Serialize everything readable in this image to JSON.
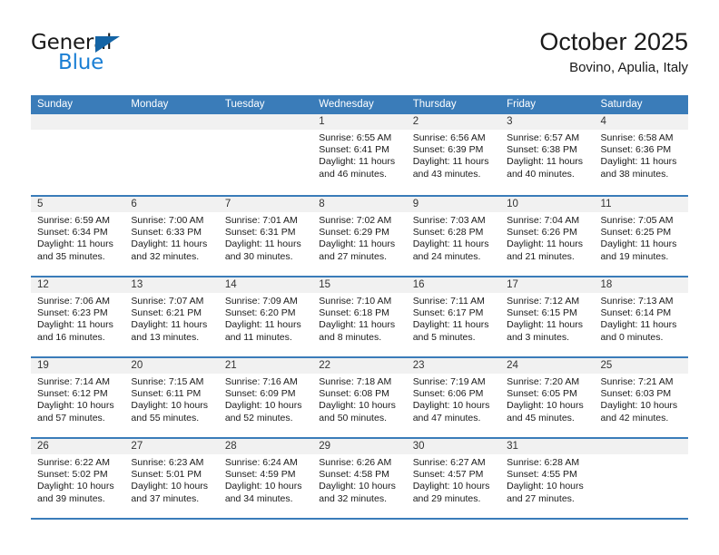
{
  "brand": {
    "name_part1": "General",
    "name_part2": "Blue",
    "accent_color": "#1b7fd4",
    "triangle_color": "#1464a5",
    "triangle_icon": "triangle-icon"
  },
  "header": {
    "title": "October 2025",
    "subtitle": "Bovino, Apulia, Italy"
  },
  "calendar": {
    "header_bg": "#3a7cb9",
    "day_band_bg": "#f1f1f1",
    "weekday_headers": [
      "Sunday",
      "Monday",
      "Tuesday",
      "Wednesday",
      "Thursday",
      "Friday",
      "Saturday"
    ],
    "weeks": [
      [
        {
          "day": "",
          "empty": true,
          "sunrise": "",
          "sunset": "",
          "daylight_line1": "",
          "daylight_line2": ""
        },
        {
          "day": "",
          "empty": true,
          "sunrise": "",
          "sunset": "",
          "daylight_line1": "",
          "daylight_line2": ""
        },
        {
          "day": "",
          "empty": true,
          "sunrise": "",
          "sunset": "",
          "daylight_line1": "",
          "daylight_line2": ""
        },
        {
          "day": "1",
          "empty": false,
          "sunrise": "Sunrise: 6:55 AM",
          "sunset": "Sunset: 6:41 PM",
          "daylight_line1": "Daylight: 11 hours",
          "daylight_line2": "and 46 minutes."
        },
        {
          "day": "2",
          "empty": false,
          "sunrise": "Sunrise: 6:56 AM",
          "sunset": "Sunset: 6:39 PM",
          "daylight_line1": "Daylight: 11 hours",
          "daylight_line2": "and 43 minutes."
        },
        {
          "day": "3",
          "empty": false,
          "sunrise": "Sunrise: 6:57 AM",
          "sunset": "Sunset: 6:38 PM",
          "daylight_line1": "Daylight: 11 hours",
          "daylight_line2": "and 40 minutes."
        },
        {
          "day": "4",
          "empty": false,
          "sunrise": "Sunrise: 6:58 AM",
          "sunset": "Sunset: 6:36 PM",
          "daylight_line1": "Daylight: 11 hours",
          "daylight_line2": "and 38 minutes."
        }
      ],
      [
        {
          "day": "5",
          "empty": false,
          "sunrise": "Sunrise: 6:59 AM",
          "sunset": "Sunset: 6:34 PM",
          "daylight_line1": "Daylight: 11 hours",
          "daylight_line2": "and 35 minutes."
        },
        {
          "day": "6",
          "empty": false,
          "sunrise": "Sunrise: 7:00 AM",
          "sunset": "Sunset: 6:33 PM",
          "daylight_line1": "Daylight: 11 hours",
          "daylight_line2": "and 32 minutes."
        },
        {
          "day": "7",
          "empty": false,
          "sunrise": "Sunrise: 7:01 AM",
          "sunset": "Sunset: 6:31 PM",
          "daylight_line1": "Daylight: 11 hours",
          "daylight_line2": "and 30 minutes."
        },
        {
          "day": "8",
          "empty": false,
          "sunrise": "Sunrise: 7:02 AM",
          "sunset": "Sunset: 6:29 PM",
          "daylight_line1": "Daylight: 11 hours",
          "daylight_line2": "and 27 minutes."
        },
        {
          "day": "9",
          "empty": false,
          "sunrise": "Sunrise: 7:03 AM",
          "sunset": "Sunset: 6:28 PM",
          "daylight_line1": "Daylight: 11 hours",
          "daylight_line2": "and 24 minutes."
        },
        {
          "day": "10",
          "empty": false,
          "sunrise": "Sunrise: 7:04 AM",
          "sunset": "Sunset: 6:26 PM",
          "daylight_line1": "Daylight: 11 hours",
          "daylight_line2": "and 21 minutes."
        },
        {
          "day": "11",
          "empty": false,
          "sunrise": "Sunrise: 7:05 AM",
          "sunset": "Sunset: 6:25 PM",
          "daylight_line1": "Daylight: 11 hours",
          "daylight_line2": "and 19 minutes."
        }
      ],
      [
        {
          "day": "12",
          "empty": false,
          "sunrise": "Sunrise: 7:06 AM",
          "sunset": "Sunset: 6:23 PM",
          "daylight_line1": "Daylight: 11 hours",
          "daylight_line2": "and 16 minutes."
        },
        {
          "day": "13",
          "empty": false,
          "sunrise": "Sunrise: 7:07 AM",
          "sunset": "Sunset: 6:21 PM",
          "daylight_line1": "Daylight: 11 hours",
          "daylight_line2": "and 13 minutes."
        },
        {
          "day": "14",
          "empty": false,
          "sunrise": "Sunrise: 7:09 AM",
          "sunset": "Sunset: 6:20 PM",
          "daylight_line1": "Daylight: 11 hours",
          "daylight_line2": "and 11 minutes."
        },
        {
          "day": "15",
          "empty": false,
          "sunrise": "Sunrise: 7:10 AM",
          "sunset": "Sunset: 6:18 PM",
          "daylight_line1": "Daylight: 11 hours",
          "daylight_line2": "and 8 minutes."
        },
        {
          "day": "16",
          "empty": false,
          "sunrise": "Sunrise: 7:11 AM",
          "sunset": "Sunset: 6:17 PM",
          "daylight_line1": "Daylight: 11 hours",
          "daylight_line2": "and 5 minutes."
        },
        {
          "day": "17",
          "empty": false,
          "sunrise": "Sunrise: 7:12 AM",
          "sunset": "Sunset: 6:15 PM",
          "daylight_line1": "Daylight: 11 hours",
          "daylight_line2": "and 3 minutes."
        },
        {
          "day": "18",
          "empty": false,
          "sunrise": "Sunrise: 7:13 AM",
          "sunset": "Sunset: 6:14 PM",
          "daylight_line1": "Daylight: 11 hours",
          "daylight_line2": "and 0 minutes."
        }
      ],
      [
        {
          "day": "19",
          "empty": false,
          "sunrise": "Sunrise: 7:14 AM",
          "sunset": "Sunset: 6:12 PM",
          "daylight_line1": "Daylight: 10 hours",
          "daylight_line2": "and 57 minutes."
        },
        {
          "day": "20",
          "empty": false,
          "sunrise": "Sunrise: 7:15 AM",
          "sunset": "Sunset: 6:11 PM",
          "daylight_line1": "Daylight: 10 hours",
          "daylight_line2": "and 55 minutes."
        },
        {
          "day": "21",
          "empty": false,
          "sunrise": "Sunrise: 7:16 AM",
          "sunset": "Sunset: 6:09 PM",
          "daylight_line1": "Daylight: 10 hours",
          "daylight_line2": "and 52 minutes."
        },
        {
          "day": "22",
          "empty": false,
          "sunrise": "Sunrise: 7:18 AM",
          "sunset": "Sunset: 6:08 PM",
          "daylight_line1": "Daylight: 10 hours",
          "daylight_line2": "and 50 minutes."
        },
        {
          "day": "23",
          "empty": false,
          "sunrise": "Sunrise: 7:19 AM",
          "sunset": "Sunset: 6:06 PM",
          "daylight_line1": "Daylight: 10 hours",
          "daylight_line2": "and 47 minutes."
        },
        {
          "day": "24",
          "empty": false,
          "sunrise": "Sunrise: 7:20 AM",
          "sunset": "Sunset: 6:05 PM",
          "daylight_line1": "Daylight: 10 hours",
          "daylight_line2": "and 45 minutes."
        },
        {
          "day": "25",
          "empty": false,
          "sunrise": "Sunrise: 7:21 AM",
          "sunset": "Sunset: 6:03 PM",
          "daylight_line1": "Daylight: 10 hours",
          "daylight_line2": "and 42 minutes."
        }
      ],
      [
        {
          "day": "26",
          "empty": false,
          "sunrise": "Sunrise: 6:22 AM",
          "sunset": "Sunset: 5:02 PM",
          "daylight_line1": "Daylight: 10 hours",
          "daylight_line2": "and 39 minutes."
        },
        {
          "day": "27",
          "empty": false,
          "sunrise": "Sunrise: 6:23 AM",
          "sunset": "Sunset: 5:01 PM",
          "daylight_line1": "Daylight: 10 hours",
          "daylight_line2": "and 37 minutes."
        },
        {
          "day": "28",
          "empty": false,
          "sunrise": "Sunrise: 6:24 AM",
          "sunset": "Sunset: 4:59 PM",
          "daylight_line1": "Daylight: 10 hours",
          "daylight_line2": "and 34 minutes."
        },
        {
          "day": "29",
          "empty": false,
          "sunrise": "Sunrise: 6:26 AM",
          "sunset": "Sunset: 4:58 PM",
          "daylight_line1": "Daylight: 10 hours",
          "daylight_line2": "and 32 minutes."
        },
        {
          "day": "30",
          "empty": false,
          "sunrise": "Sunrise: 6:27 AM",
          "sunset": "Sunset: 4:57 PM",
          "daylight_line1": "Daylight: 10 hours",
          "daylight_line2": "and 29 minutes."
        },
        {
          "day": "31",
          "empty": false,
          "sunrise": "Sunrise: 6:28 AM",
          "sunset": "Sunset: 4:55 PM",
          "daylight_line1": "Daylight: 10 hours",
          "daylight_line2": "and 27 minutes."
        },
        {
          "day": "",
          "empty": true,
          "sunrise": "",
          "sunset": "",
          "daylight_line1": "",
          "daylight_line2": ""
        }
      ]
    ]
  }
}
